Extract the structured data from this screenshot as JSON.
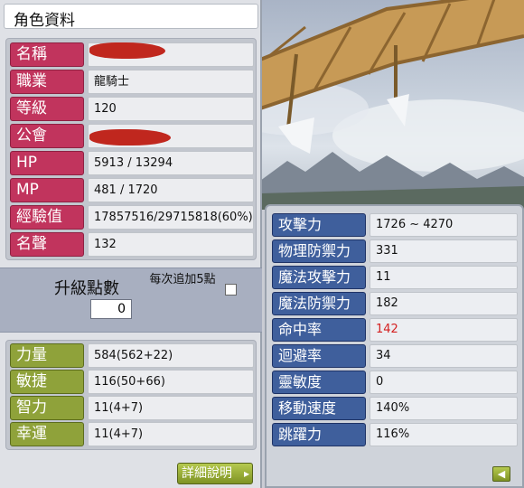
{
  "window": {
    "title": "角色資料"
  },
  "info": [
    {
      "label": "名稱",
      "value": ""
    },
    {
      "label": "職業",
      "value": "龍騎士"
    },
    {
      "label": "等級",
      "value": "120"
    },
    {
      "label": "公會",
      "value": ""
    },
    {
      "label": "HP",
      "value": "5913 / 13294"
    },
    {
      "label": "MP",
      "value": "481 / 1720"
    },
    {
      "label": "經驗值",
      "value": "17857516/29715818(60%)"
    },
    {
      "label": "名聲",
      "value": "132"
    }
  ],
  "ability_points": {
    "label": "升級點數",
    "value": "0",
    "add_each_label": "每次追加5點",
    "add_each_checked": false
  },
  "stats": [
    {
      "label": "力量",
      "value": "584(562+22)"
    },
    {
      "label": "敏捷",
      "value": "116(50+66)"
    },
    {
      "label": "智力",
      "value": "11(4+7)"
    },
    {
      "label": "幸運",
      "value": "11(4+7)"
    }
  ],
  "detail_button": {
    "label": "詳細說明",
    "icon": "chevron-right-icon"
  },
  "details": [
    {
      "label": "攻擊力",
      "value": "1726 ~ 4270"
    },
    {
      "label": "物理防禦力",
      "value": "331"
    },
    {
      "label": "魔法攻擊力",
      "value": "11"
    },
    {
      "label": "魔法防禦力",
      "value": "182"
    },
    {
      "label": "命中率",
      "value": "142",
      "highlight": "#d42020"
    },
    {
      "label": "迴避率",
      "value": "34"
    },
    {
      "label": "靈敏度",
      "value": "0"
    },
    {
      "label": "移動速度",
      "value": "140%"
    },
    {
      "label": "跳躍力",
      "value": "116%"
    }
  ],
  "back_button": {
    "icon": "back-arrow-icon"
  },
  "colors": {
    "info_label": "#c1345d",
    "stat_label": "#8fa23a",
    "detail_label": "#3f5f9c",
    "button": "#8fa23a"
  }
}
